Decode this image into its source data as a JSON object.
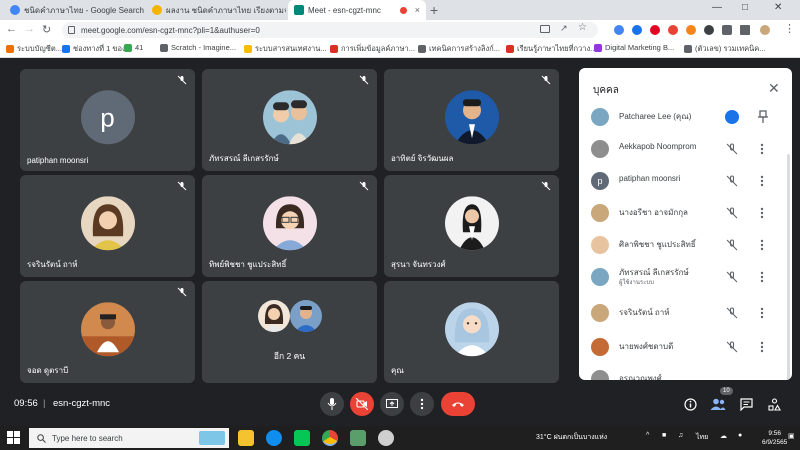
{
  "browser": {
    "tabs": [
      {
        "title": "ชนิดคำภาษาไทย - Google Search",
        "active": false,
        "color": "#4285f4"
      },
      {
        "title": "ผลงาน ชนิดคำภาษาไทย เรียงตามจำนวนคำ",
        "active": false,
        "color": "#f4b400"
      },
      {
        "title": "Meet - esn-cgzt-mnc",
        "active": true,
        "color": "#00897b"
      }
    ],
    "tab_close": "×",
    "new_tab": "+",
    "window_controls": [
      "—",
      "□",
      "✕"
    ],
    "url": "meet.google.com/esn-cgzt-mnc?pli=1&authuser=0",
    "bookmarks": [
      "ระบบบัญชีต...",
      "ช่องทางที่ 1 ของ",
      "41",
      "Scratch - Imagine...",
      "ระบบสารสนเทศงาน...",
      "การเพิ่มข้อมูลค์ภาษา...",
      "เทคนิคการสร้างลิงก์...",
      "เรียนรู้ภาษาไทยที่กวาง...",
      "Digital Marketing B...",
      "(ตัวเลข) รวมเทคนิค..."
    ],
    "bookmark_colors": [
      "#e8710a",
      "#1a73e8",
      "#34a853",
      "#5f6368",
      "#fbbc04",
      "#d93025",
      "#5f6368",
      "#d93025",
      "#9334e6",
      "#5f6368"
    ]
  },
  "meeting": {
    "time": "09:56",
    "separator": "|",
    "code": "esn-cgzt-mnc",
    "participant_count": "10",
    "tiles": [
      {
        "name": "patiphan moonsri",
        "avatar": "letter",
        "letter": "p",
        "photo_color": "#5f6a76"
      },
      {
        "name": "ภัทรสรณ์ ลีเกสรรักษ์",
        "avatar": "photo",
        "photo_color": "#7aa6c2"
      },
      {
        "name": "อาทิตย์ จิรวัฒนผล",
        "avatar": "photo",
        "photo_color": "#1e5aa8"
      },
      {
        "name": "รจรินรัตน์ ถาห์",
        "avatar": "photo",
        "photo_color": "#c9a77a"
      },
      {
        "name": "ทิพย์พิชชา ชูแประสิทธิ์",
        "avatar": "photo",
        "photo_color": "#e8c3a0"
      },
      {
        "name": "สุรนา จันทรวงศ์",
        "avatar": "photo",
        "photo_color": "#e9e9e9"
      },
      {
        "name": "จอด ดูตราบี",
        "avatar": "photo",
        "photo_color": "#c36a35"
      },
      {
        "name": "อีก 2 คน",
        "avatar": "group",
        "photo_color": "#7aa0c8"
      },
      {
        "name": "คุณ",
        "avatar": "photo",
        "photo_color": "#bcd4ea"
      }
    ]
  },
  "people_panel": {
    "title": "บุคคล",
    "close": "✕",
    "rows": [
      {
        "name": "Patcharee Lee (คุณ)",
        "sub": "",
        "avatar": "photo",
        "color": "#7aa6c2",
        "letter": "",
        "self": true
      },
      {
        "name": "Aekkapob Noomprom",
        "sub": "",
        "avatar": "photo",
        "color": "#8e8e8e",
        "letter": "",
        "self": false
      },
      {
        "name": "patiphan moonsri",
        "sub": "",
        "avatar": "letter",
        "color": "#5f6a76",
        "letter": "p",
        "self": false
      },
      {
        "name": "นางอรีชา อาจมักกุล",
        "sub": "",
        "avatar": "photo",
        "color": "#c9a77a",
        "letter": "",
        "self": false
      },
      {
        "name": "ศิลาพิชชา ชูแประสิทธิ์",
        "sub": "",
        "avatar": "photo",
        "color": "#e8c3a0",
        "letter": "",
        "self": false
      },
      {
        "name": "ภัทรสรณ์ ลีเกสรรักษ์",
        "sub": "ผู้ใช้งานระบบ",
        "avatar": "photo",
        "color": "#7aa6c2",
        "letter": "",
        "self": false
      },
      {
        "name": "รจรินรัตน์ ถาห์",
        "sub": "",
        "avatar": "photo",
        "color": "#c9a77a",
        "letter": "",
        "self": false
      },
      {
        "name": "นายพงศ์ชดาบดี",
        "sub": "",
        "avatar": "photo",
        "color": "#c36a35",
        "letter": "",
        "self": false
      },
      {
        "name": "อรุณวุณพงศ์",
        "sub": "",
        "avatar": "photo",
        "color": "#8e8e8e",
        "letter": "",
        "self": false
      }
    ]
  },
  "taskbar": {
    "search_placeholder": "Type here to search",
    "weather": "31°C  ฝนตกเป็นบางแห่ง",
    "lang": "ไทย",
    "time": "9:56",
    "date": "6/9/2565",
    "apps": [
      {
        "icon": "file-explorer-icon",
        "color": "#f4c430"
      },
      {
        "icon": "edge-icon",
        "color": "#0f8ef0"
      },
      {
        "icon": "line-icon",
        "color": "#06c755"
      },
      {
        "icon": "chrome-icon",
        "color": "#34a853"
      },
      {
        "icon": "snipping-tool-icon",
        "color": "#5c9e6b"
      },
      {
        "icon": "settings-icon",
        "color": "#cfcfcf"
      }
    ]
  }
}
